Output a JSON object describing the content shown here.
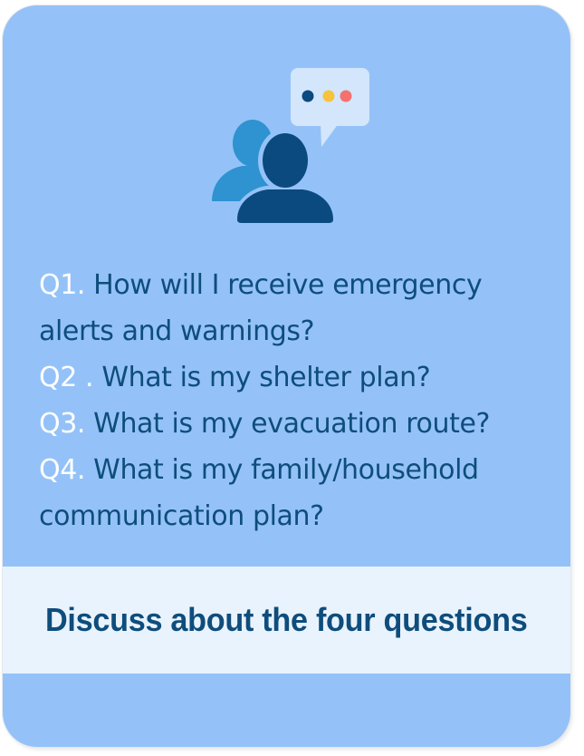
{
  "colors": {
    "card_background": "#94c2f8",
    "band_background": "#e9f3fd",
    "text_dark_blue": "#0e4d7c",
    "question_number": "#ffffff",
    "person_back": "#2e93d0",
    "person_front": "#0b4a7e",
    "bubble": "#d3e6fb",
    "dot_dark": "#0b4a7e",
    "dot_yellow": "#f7c23c",
    "dot_red": "#f4716f"
  },
  "icons": {
    "illustration": "two-people-discussion-icon",
    "bubble": "speech-bubble-icon"
  },
  "questions": [
    {
      "number": "Q1.",
      "text": " How will I receive emergency alerts and warnings?"
    },
    {
      "number": "Q2 .",
      "text": " What is my shelter plan?"
    },
    {
      "number": "Q3.",
      "text": " What is my evacuation route?"
    },
    {
      "number": "Q4.",
      "text": " What is my family/household communication plan?"
    }
  ],
  "footer": {
    "text": "Discuss about the four questions"
  }
}
